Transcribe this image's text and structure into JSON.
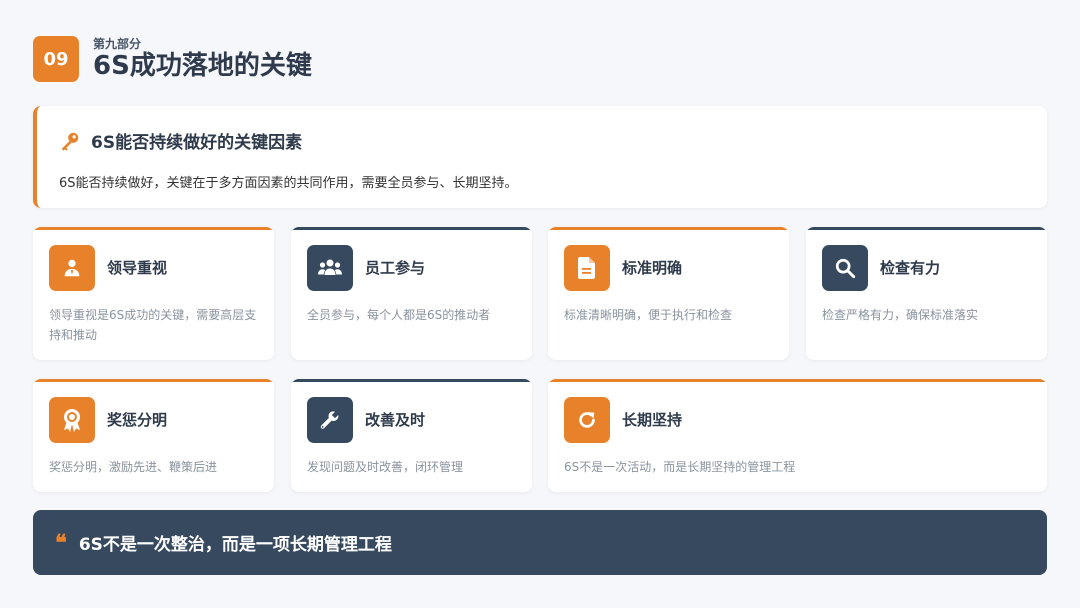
{
  "header": {
    "number": "09",
    "section_label": "第九部分",
    "title": "6S成功落地的关键"
  },
  "intro": {
    "icon": "key-icon",
    "title": "6S能否持续做好的关键因素",
    "body": "6S能否持续做好，关键在于多方面因素的共同作用，需要全员参与、长期坚持。"
  },
  "cards": [
    {
      "icon": "person-tie-icon",
      "title": "领导重视",
      "desc": "领导重视是6S成功的关键，需要高层支持和推动",
      "accent": "#e8822a"
    },
    {
      "icon": "people-group-icon",
      "title": "员工参与",
      "desc": "全员参与，每个人都是6S的推动者",
      "accent": "#36495e"
    },
    {
      "icon": "document-icon",
      "title": "标准明确",
      "desc": "标准清晰明确，便于执行和检查",
      "accent": "#e8822a"
    },
    {
      "icon": "search-icon",
      "title": "检查有力",
      "desc": "检查严格有力，确保标准落实",
      "accent": "#36495e"
    },
    {
      "icon": "award-icon",
      "title": "奖惩分明",
      "desc": "奖惩分明，激励先进、鞭策后进",
      "accent": "#e8822a"
    },
    {
      "icon": "wrench-icon",
      "title": "改善及时",
      "desc": "发现问题及时改善，闭环管理",
      "accent": "#36495e"
    },
    {
      "icon": "redo-icon",
      "title": "长期坚持",
      "desc": "6S不是一次活动，而是长期坚持的管理工程",
      "accent": "#e8822a"
    }
  ],
  "quote": {
    "mark": "❝",
    "text": "6S不是一次整治，而是一项长期管理工程"
  },
  "colors": {
    "orange": "#e8822a",
    "navy": "#36495e",
    "background": "#f5f7fa"
  }
}
